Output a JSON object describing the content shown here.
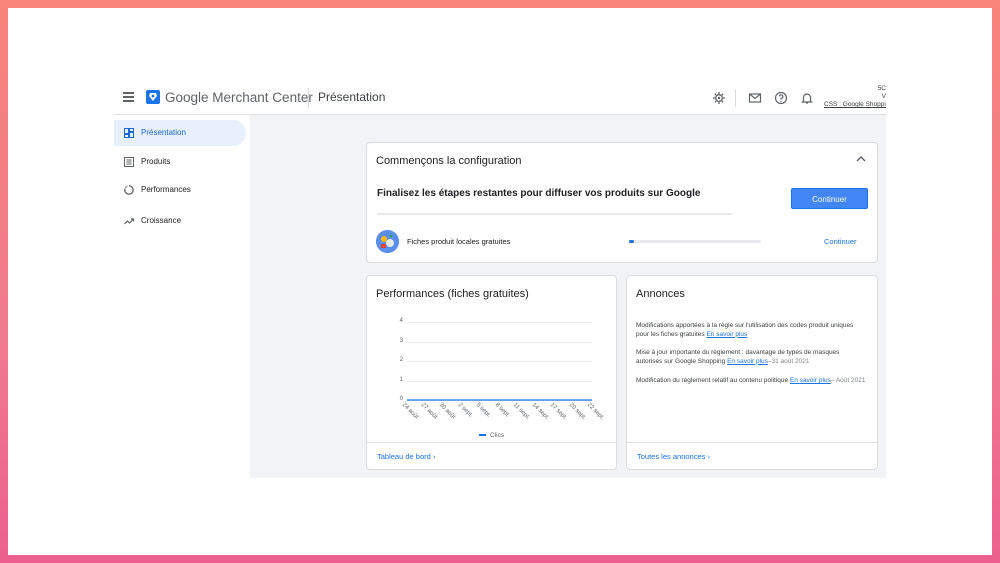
{
  "app": {
    "logo_text": "Google Merchant Center",
    "page_title": "Présentation",
    "account": {
      "line1": "5C",
      "line2": "V",
      "line3": "CSS : Google Shopping"
    }
  },
  "sidebar": {
    "items": [
      {
        "label": "Présentation",
        "icon": "dashboard-icon",
        "active": true
      },
      {
        "label": "Produits",
        "icon": "list-icon",
        "active": false
      },
      {
        "label": "Performances",
        "icon": "donut-icon",
        "active": false
      },
      {
        "label": "Croissance",
        "icon": "trending-up-icon",
        "active": false
      }
    ]
  },
  "setup": {
    "title": "Commençons la configuration",
    "heading": "Finalisez les étapes restantes pour diffuser vos produits sur Google",
    "button_label": "Continuer",
    "task": {
      "label": "Fiches produit locales gratuites",
      "progress": 0.04,
      "action_label": "Continuer"
    }
  },
  "performance": {
    "title": "Performances (fiches gratuites)",
    "footer_link": "Tableau de bord",
    "chart_data": {
      "type": "line",
      "x": [
        "24 août",
        "27 août",
        "30 août",
        "2 sept.",
        "5 sept.",
        "8 sept.",
        "11 sept.",
        "14 sept.",
        "17 sept.",
        "20 sept.",
        "22 sept."
      ],
      "series": [
        {
          "name": "Clics",
          "values": [
            0,
            0,
            0,
            0,
            0,
            0,
            0,
            0,
            0,
            0,
            0
          ]
        }
      ],
      "yticks": [
        "0",
        "1",
        "2",
        "3",
        "4"
      ],
      "ylim": [
        0,
        4
      ],
      "grid": true,
      "legend": "bottom",
      "color": "#1a73e8"
    }
  },
  "announcements": {
    "title": "Annonces",
    "items": [
      {
        "text": "Modifications apportées à la règle sur l'utilisation des codes produit uniques pour les fiches gratuites",
        "link": "En savoir plus",
        "date": ""
      },
      {
        "text": "Mise à jour importante du règlement : davantage de types de masques autorisés sur Google Shopping",
        "link": "En savoir plus",
        "date": "–31 août 2021"
      },
      {
        "text": "Modification du règlement relatif au contenu politique",
        "link": "En savoir plus",
        "date": "– Août 2021"
      }
    ],
    "footer_link": "Toutes les annonces"
  },
  "colors": {
    "accent": "#1a73e8",
    "button": "#4285f4",
    "active_nav": "#e8f0fe"
  }
}
